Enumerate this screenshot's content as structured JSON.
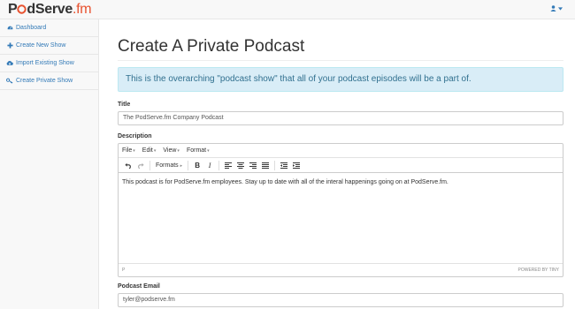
{
  "brand": {
    "part1": "P",
    "part2": "dServe",
    "part3": ".fm"
  },
  "sidebar": {
    "items": [
      {
        "label": "Dashboard",
        "icon": "dashboard-icon"
      },
      {
        "label": "Create New Show",
        "icon": "plus-icon"
      },
      {
        "label": "Import Existing Show",
        "icon": "cloud-download-icon"
      },
      {
        "label": "Create Private Show",
        "icon": "key-icon"
      }
    ]
  },
  "main": {
    "title": "Create A Private Podcast",
    "alert": "This is the overarching \"podcast show\" that all of your podcast episodes will be a part of.",
    "title_label": "Title",
    "title_value": "The PodServe.fm Company Podcast",
    "description_label": "Description",
    "email_label": "Podcast Email",
    "email_value": "tyler@podserve.fm"
  },
  "editor": {
    "menus": [
      "File",
      "Edit",
      "View",
      "Format"
    ],
    "formats_label": "Formats",
    "content": "This podcast is for PodServe.fm employees. Stay up to date with all of the interal happenings going on at PodServe.fm.",
    "path": "P",
    "powered_by": "POWERED BY TINY"
  },
  "colors": {
    "link": "#337ab7",
    "brand_accent": "#e8522f",
    "alert_bg": "#d9edf7",
    "alert_text": "#31708f"
  }
}
